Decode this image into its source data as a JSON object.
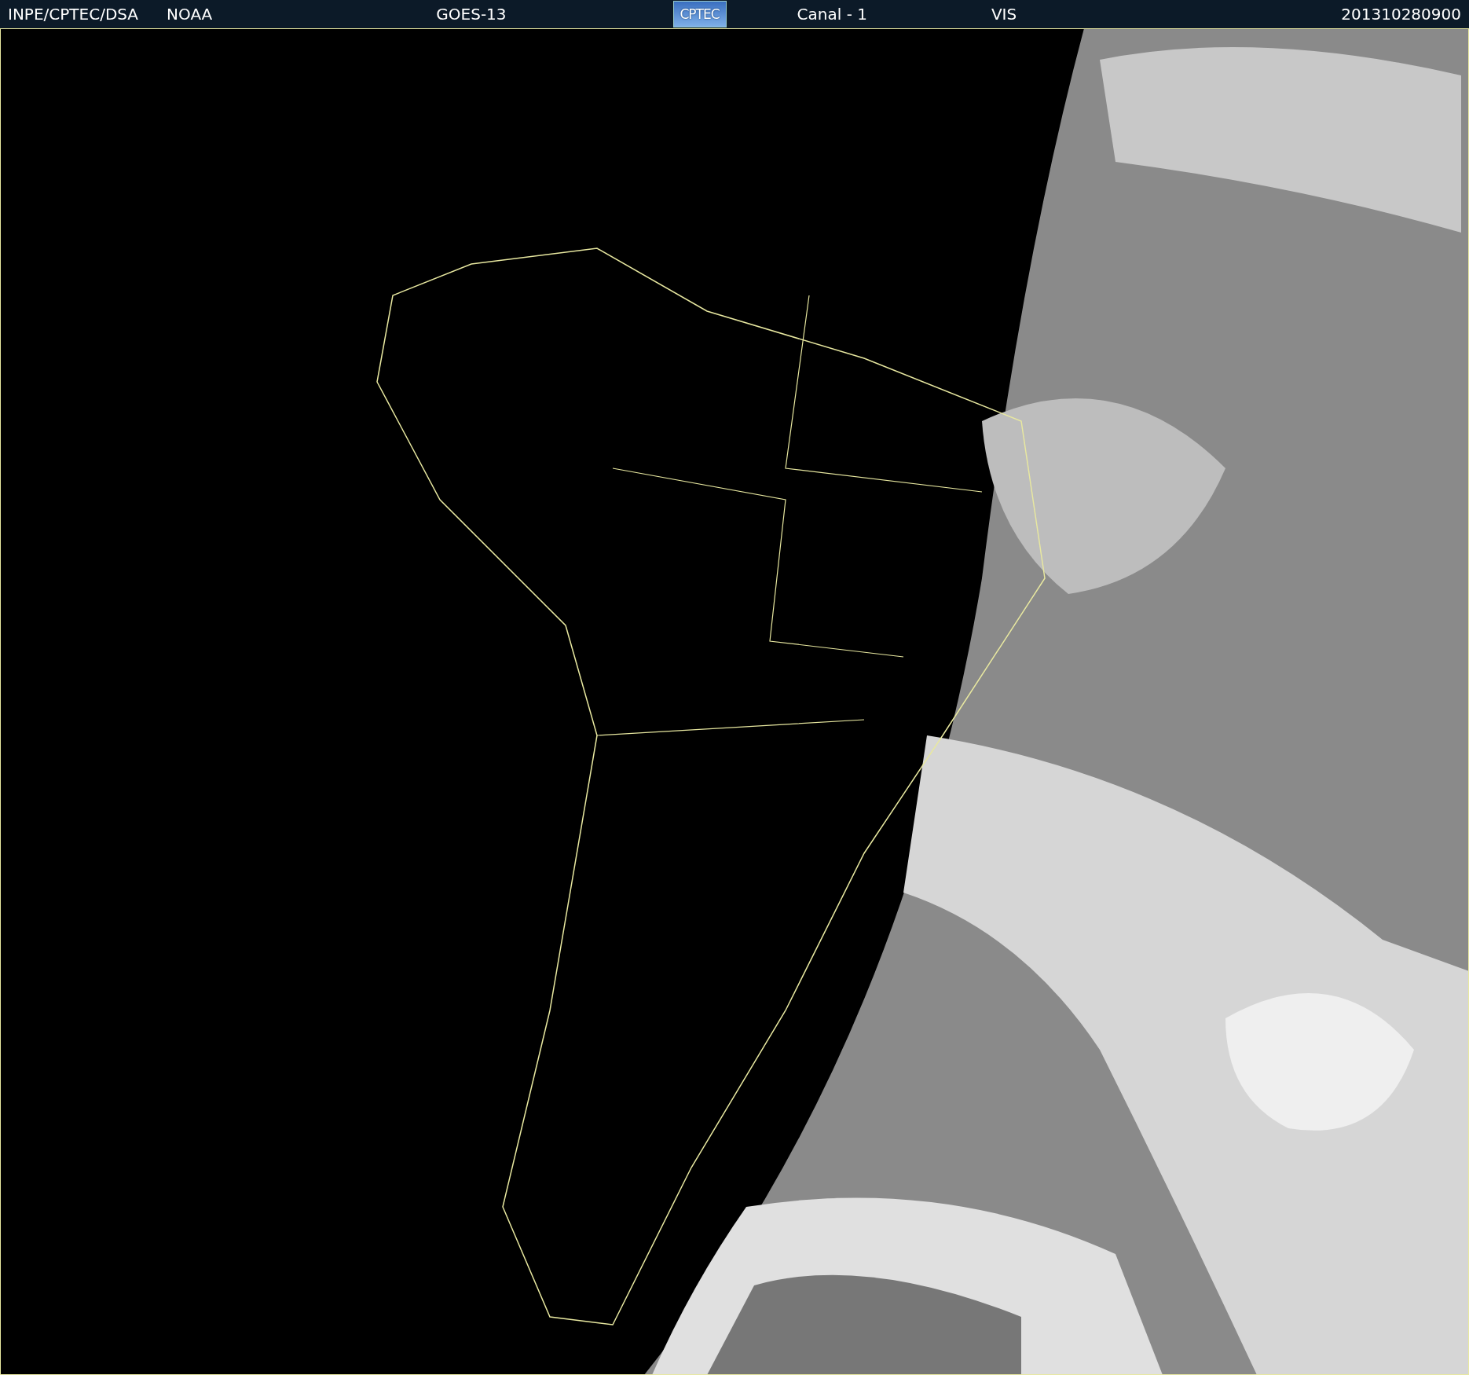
{
  "header": {
    "items": [
      {
        "kind": "text",
        "text": "INPE/CPTEC/DSA"
      },
      {
        "kind": "text",
        "text": "NOAA"
      },
      {
        "kind": "text",
        "text": "GOES-13"
      },
      {
        "kind": "logo",
        "text": "CPTEC"
      },
      {
        "kind": "text",
        "text": "Canal - 1"
      },
      {
        "kind": "text",
        "text": "VIS"
      },
      {
        "kind": "text",
        "text": "201310280900"
      }
    ]
  }
}
